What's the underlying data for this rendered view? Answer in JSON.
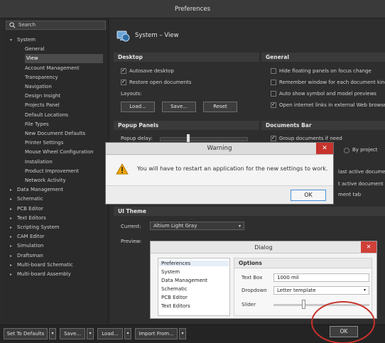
{
  "window": {
    "title": "Preferences"
  },
  "search": {
    "placeholder": "Search"
  },
  "tree": [
    {
      "label": "System",
      "level": 0,
      "expanded": true
    },
    {
      "label": "General",
      "level": 1
    },
    {
      "label": "View",
      "level": 1,
      "selected": true
    },
    {
      "label": "Account Management",
      "level": 1
    },
    {
      "label": "Transparency",
      "level": 1
    },
    {
      "label": "Navigation",
      "level": 1
    },
    {
      "label": "Design Insight",
      "level": 1
    },
    {
      "label": "Projects Panel",
      "level": 1
    },
    {
      "label": "Default Locations",
      "level": 1
    },
    {
      "label": "File Types",
      "level": 1
    },
    {
      "label": "New Document Defaults",
      "level": 1
    },
    {
      "label": "Printer Settings",
      "level": 1
    },
    {
      "label": "Mouse Wheel Configuration",
      "level": 1
    },
    {
      "label": "Installation",
      "level": 1
    },
    {
      "label": "Product Improvement",
      "level": 1
    },
    {
      "label": "Network Activity",
      "level": 1
    },
    {
      "label": "Data Management",
      "level": 0
    },
    {
      "label": "Schematic",
      "level": 0
    },
    {
      "label": "PCB Editor",
      "level": 0
    },
    {
      "label": "Text Editors",
      "level": 0
    },
    {
      "label": "Scripting System",
      "level": 0
    },
    {
      "label": "CAM Editor",
      "level": 0
    },
    {
      "label": "Simulation",
      "level": 0
    },
    {
      "label": "Draftsman",
      "level": 0
    },
    {
      "label": "Multi-board Schematic",
      "level": 0
    },
    {
      "label": "Multi-board Assembly",
      "level": 0
    }
  ],
  "page": {
    "title": "System – View"
  },
  "desktop": {
    "header": "Desktop",
    "autosave": "Autosave desktop",
    "restore": "Restore open documents",
    "layouts_label": "Layouts:",
    "load": "Load...",
    "save": "Save...",
    "reset": "Reset"
  },
  "general": {
    "header": "General",
    "items": [
      {
        "label": "Hide floating panels on focus change",
        "checked": false
      },
      {
        "label": "Remember window for each document kind",
        "checked": false
      },
      {
        "label": "Auto show symbol and model previews",
        "checked": false
      },
      {
        "label": "Open internet links in external Web browser",
        "checked": true
      }
    ]
  },
  "popup": {
    "header": "Popup Panels",
    "delay_label": "Popup delay:"
  },
  "documents_bar": {
    "header": "Documents Bar",
    "group": "Group documents if need",
    "by_project": "By project",
    "frag1": "last active document",
    "frag2": "t active document",
    "frag3": "ment tab"
  },
  "ui_theme": {
    "header": "UI Theme",
    "current_label": "Current:",
    "current_value": "Altium Light Gray",
    "preview_label": "Preview:"
  },
  "warning": {
    "title": "Warning",
    "message": "You will have to restart an application for the new settings to work.",
    "ok": "OK"
  },
  "preview_dialog": {
    "title": "Dialog",
    "list": [
      "Preferences",
      "System",
      "Data Management",
      "Schematic",
      "PCB Editor",
      "Text Editors"
    ],
    "options_header": "Options",
    "textbox_label": "Text Box",
    "textbox_value": "1000 mil",
    "dropdown_label": "Dropdown",
    "dropdown_value": "Letter template",
    "slider_label": "Slider"
  },
  "bottom": {
    "set_defaults": "Set To Defaults",
    "save": "Save...",
    "load": "Load...",
    "import": "Import From...",
    "ok": "OK"
  },
  "colors": {
    "accent_red": "#c8322c",
    "warning_amber": "#f0a500"
  }
}
